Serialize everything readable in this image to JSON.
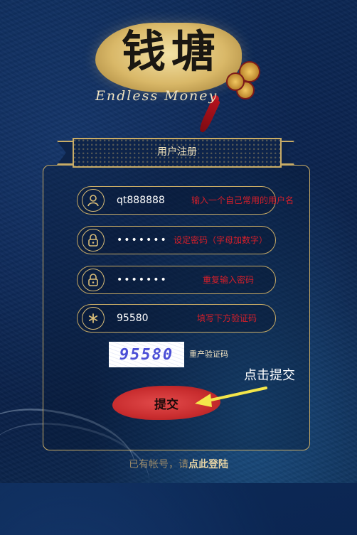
{
  "logo": {
    "title": "钱塘",
    "subtitle": "Endless Money"
  },
  "banner": {
    "title": "用户注册"
  },
  "fields": [
    {
      "icon": "user-icon",
      "value": "qt888888",
      "hint": "输入一个自己常用的用户名"
    },
    {
      "icon": "lock-icon",
      "value": "•••••••",
      "hint": "设定密码（字母加数字）"
    },
    {
      "icon": "lock-icon",
      "value": "•••••••",
      "hint": "重复输入密码"
    },
    {
      "icon": "asterisk-icon",
      "value": "95580",
      "hint": "填写下方验证码"
    }
  ],
  "captcha": {
    "code": "95580",
    "refresh_label": "重产验证码"
  },
  "submit": {
    "label": "提交"
  },
  "annotation": {
    "text": "点击提交"
  },
  "footer": {
    "prefix": "已有帐号，请",
    "link": "点此登陆"
  },
  "colors": {
    "gold": "#c9ac66",
    "hint_red": "#d51f2a",
    "background": "#0b2450",
    "submit_red": "#c82c2e"
  }
}
